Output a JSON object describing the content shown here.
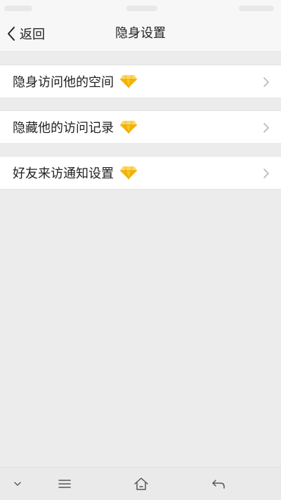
{
  "header": {
    "back_label": "返回",
    "title": "隐身设置"
  },
  "menu": {
    "items": [
      {
        "label": "隐身访问他的空间",
        "icon": "diamond-icon"
      },
      {
        "label": "隐藏他的访问记录",
        "icon": "diamond-icon"
      },
      {
        "label": "好友来访通知设置",
        "icon": "diamond-icon"
      }
    ]
  },
  "system_nav": {
    "buttons": [
      "collapse-down-icon",
      "menu-icon",
      "home-icon",
      "back-arrow-icon"
    ]
  },
  "colors": {
    "background": "#ececec",
    "bar_background": "#f7f7f7",
    "diamond_gold": "#f5b400",
    "diamond_light": "#ffd75a",
    "chevron": "#b8b8b8"
  }
}
